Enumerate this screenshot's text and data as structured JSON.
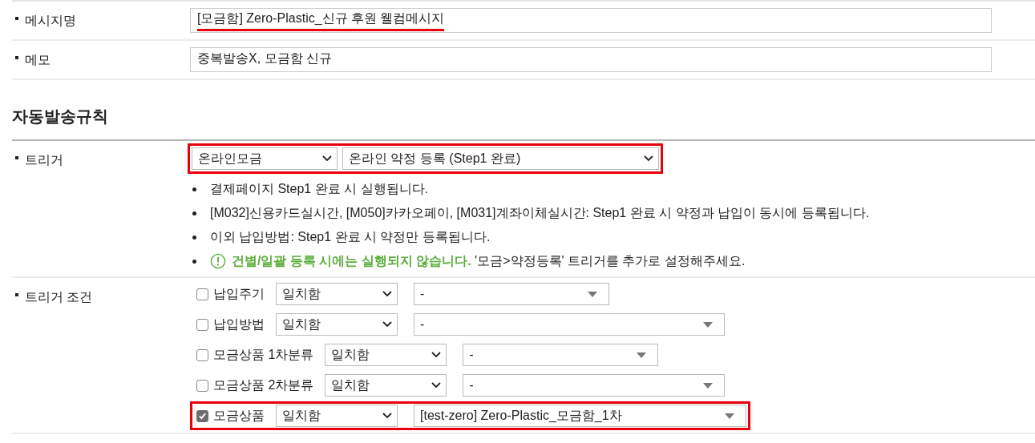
{
  "fields": [
    {
      "label": "메시지명",
      "value": "[모금함] Zero-Plastic_신규 후원 웰컴메시지",
      "highlighted": true
    },
    {
      "label": "메모",
      "value": "중복발송X, 모금함 신규",
      "highlighted": false
    }
  ],
  "section_title": "자동발송규칙",
  "trigger": {
    "label": "트리거",
    "highlighted": true,
    "category": "온라인모금",
    "event": "온라인 약정 등록 (Step1 완료)",
    "notes": [
      {
        "kind": "note",
        "text": "결제페이지 Step1 완료 시 실행됩니다."
      },
      {
        "kind": "note",
        "text": "[M032]신용카드실시간, [M050]카카오페이, [M031]계좌이체실시간: Step1 완료 시 약정과 납입이 동시에 등록됩니다."
      },
      {
        "kind": "note",
        "text": "이외 납입방법: Step1 완료 시 약정만 등록됩니다."
      },
      {
        "kind": "warning",
        "text": "**건별/일괄 등록 시에는 실행되지 않습니다.** '모금>약정등록' 트리거를 추가로 설정해주세요."
      }
    ]
  },
  "conditions": {
    "label": "트리거 조건",
    "rows": [
      {
        "label": "납입주기",
        "checked": false,
        "highlighted": false,
        "operator": "일치함",
        "value": "-"
      },
      {
        "label": "납입방법",
        "checked": false,
        "highlighted": false,
        "operator": "일치함",
        "value": "-"
      },
      {
        "label": "모금상품 1차분류",
        "checked": false,
        "highlighted": false,
        "operator": "일치함",
        "value": "-"
      },
      {
        "label": "모금상품 2차분류",
        "checked": false,
        "highlighted": false,
        "operator": "일치함",
        "value": "-"
      },
      {
        "label": "모금상품",
        "checked": true,
        "highlighted": true,
        "operator": "일치함",
        "value": "[test-zero] Zero-Plastic_모금함_1차"
      }
    ]
  }
}
